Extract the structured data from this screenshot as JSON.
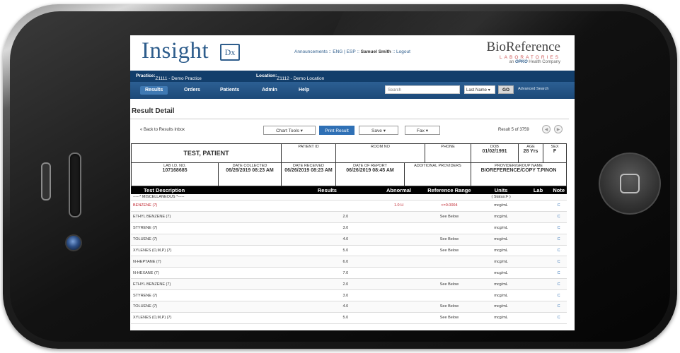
{
  "header": {
    "logo_text": "Insight",
    "logo_badge": "Dx",
    "links": {
      "announcements": "Announcements",
      "sep1": "::",
      "eng": "ENG",
      "sep2": "|",
      "esp": "ESP",
      "sep3": "::",
      "user": "Samuel Smith",
      "sep4": "::",
      "logout": "Logout"
    },
    "brand_name": "BioReference",
    "brand_sub": "LABORATORIES",
    "brand_tagline_prefix": "an",
    "brand_tagline_brand": "OPKO",
    "brand_tagline_suffix": "Health Company"
  },
  "practice_bar": {
    "practice_label": "Practice:",
    "practice_value": "Z1111 - Demo Practice",
    "location_label": "Location:",
    "location_value": "Z1112 - Demo Location"
  },
  "nav": {
    "items": [
      "Results",
      "Orders",
      "Patients",
      "Admin",
      "Help"
    ],
    "search_value": "Search",
    "search_type": "Last Name",
    "go_label": "GO",
    "advanced_search": "Advanced Search"
  },
  "page": {
    "title": "Result Detail",
    "back_link": "« Back to Results Inbox",
    "chart_tools": "Chart Tools",
    "print_result": "Print Result",
    "save": "Save",
    "fax": "Fax",
    "result_counter": "Result 5 of 3759"
  },
  "patient": {
    "name": "TEST, PATIENT",
    "patient_id_label": "PATIENT ID",
    "patient_id": "",
    "room_label": "ROOM NO",
    "room": "",
    "phone_label": "PHONE",
    "phone": "",
    "dob_label": "DOB",
    "dob": "01/02/1991",
    "age_label": "AGE",
    "age": "28 Yrs",
    "sex_label": "SEX",
    "sex": "F",
    "lab_id_label": "LAB I.D. NO.",
    "lab_id": "107168685",
    "collected_label": "DATE COLLECTED",
    "collected": "06/26/2019 08:23 AM",
    "received_label": "DATE RECEIVED",
    "received": "06/26/2019 08:23 AM",
    "report_label": "DATE OF REPORT",
    "report": "06/26/2019 08:45 AM",
    "providers_label": "ADDITIONAL PROVIDERS",
    "provider_group_label": "PROVIDER/GROUP NAME",
    "provider_group": "BIOREFERENCE/COPY T.PINON"
  },
  "results": {
    "columns": [
      "Test Description",
      "Results",
      "Abnormal",
      "Reference Range",
      "Units",
      "Lab",
      "Note"
    ],
    "section": "-----* MISCELLANEOUS *-----",
    "section_status": "( Status:F )",
    "rows": [
      {
        "desc": "BENZENE (7)",
        "result": "",
        "abnormal": "1.0 H",
        "range": "<=0.0004",
        "units": "mcg/mL",
        "lab": "",
        "note": "C",
        "flag": true
      },
      {
        "desc": "ETHYL BENZENE (7)",
        "result": "2.0",
        "abnormal": "",
        "range": "See Below",
        "units": "mcg/mL",
        "lab": "",
        "note": "C",
        "flag": false
      },
      {
        "desc": "STYRENE (7)",
        "result": "3.0",
        "abnormal": "",
        "range": "",
        "units": "mcg/mL",
        "lab": "",
        "note": "C",
        "flag": false
      },
      {
        "desc": "TOLUENE (7)",
        "result": "4.0",
        "abnormal": "",
        "range": "See Below",
        "units": "mcg/mL",
        "lab": "",
        "note": "C",
        "flag": false
      },
      {
        "desc": "XYLENES (O,M,P) (7)",
        "result": "5.0",
        "abnormal": "",
        "range": "See Below",
        "units": "mcg/mL",
        "lab": "",
        "note": "C",
        "flag": false
      },
      {
        "desc": "N-HEPTANE (7)",
        "result": "6.0",
        "abnormal": "",
        "range": "",
        "units": "mcg/mL",
        "lab": "",
        "note": "C",
        "flag": false
      },
      {
        "desc": "N-HEXANE (7)",
        "result": "7.0",
        "abnormal": "",
        "range": "",
        "units": "mcg/mL",
        "lab": "",
        "note": "C",
        "flag": false
      },
      {
        "desc": "ETHYL BENZENE (7)",
        "result": "2.0",
        "abnormal": "",
        "range": "See Below",
        "units": "mcg/mL",
        "lab": "",
        "note": "C",
        "flag": false
      },
      {
        "desc": "STYRENE (7)",
        "result": "3.0",
        "abnormal": "",
        "range": "",
        "units": "mcg/mL",
        "lab": "",
        "note": "C",
        "flag": false
      },
      {
        "desc": "TOLUENE (7)",
        "result": "4.0",
        "abnormal": "",
        "range": "See Below",
        "units": "mcg/mL",
        "lab": "",
        "note": "C",
        "flag": false
      },
      {
        "desc": "XYLENES (O,M,P) (7)",
        "result": "5.0",
        "abnormal": "",
        "range": "See Below",
        "units": "mcg/mL",
        "lab": "",
        "note": "C",
        "flag": false
      }
    ]
  },
  "icons": {
    "prev": "chevron-left-icon",
    "next": "chevron-right-icon",
    "home": "home-square-icon",
    "dropdown": "caret-down-icon"
  },
  "colors": {
    "brand_blue": "#2e5d8c",
    "nav_dark": "#123e6b",
    "primary_button": "#2f70b5",
    "abnormal_red": "#c0262f"
  }
}
